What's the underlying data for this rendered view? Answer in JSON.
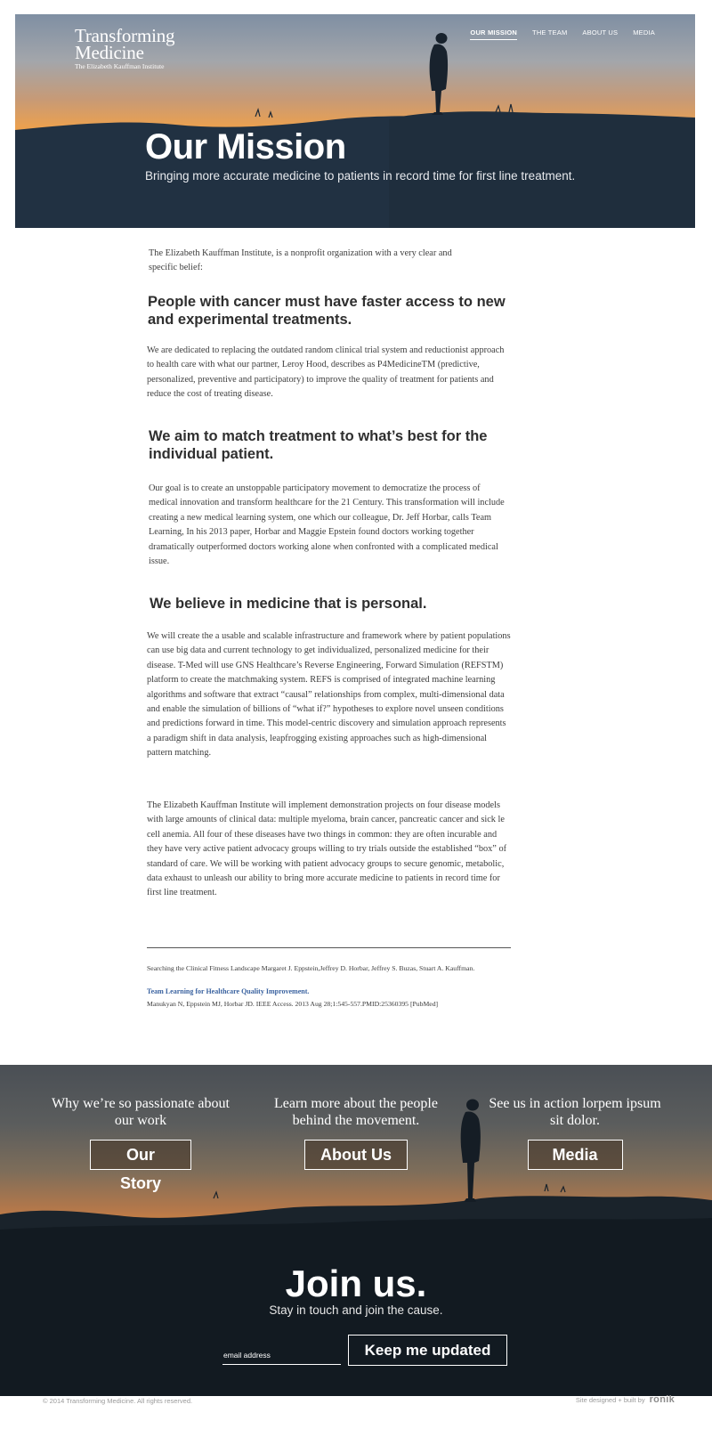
{
  "header": {
    "logo": {
      "line1": "Transforming",
      "line2": "Medicine",
      "line3": "The Elizabeth Kauffman Institute"
    },
    "nav": [
      {
        "label": "OUR MISSION",
        "active": true
      },
      {
        "label": "THE TEAM",
        "active": false
      },
      {
        "label": "ABOUT US",
        "active": false
      },
      {
        "label": "MEDIA",
        "active": false
      }
    ]
  },
  "hero": {
    "title": "Our Mission",
    "subtitle": "Bringing more accurate medicine to patients in record time for first line treatment."
  },
  "article": {
    "intro": "The Elizabeth Kauffman Institute, is a nonprofit organization with a very clear and specific belief:",
    "heading1": "People with cancer must have faster access to new and experimental treatments.",
    "para1": "We are dedicated to replacing the outdated random clinical trial system and reductionist approach to health care with what our partner, Leroy Hood, describes as P4MedicineTM (predictive, personalized, preventive and participatory) to improve the quality of treatment for patients and reduce the cost of treating disease.",
    "heading2": "We aim to match treatment to what’s best for the individual patient.",
    "para2": "Our goal is to create an unstoppable participatory movement to democratize the process of medical innovation and transform healthcare for the 21 Century. This transformation will include creating a new medical learning system, one which our colleague, Dr. Jeff Horbar, calls Team Learning, In his 2013 paper, Horbar and Maggie Epstein found doctors working together dramatically outperformed doctors working alone when confronted with a complicated medical issue.",
    "heading3": "We believe in medicine that is personal.",
    "para3": "We will create the a usable and scalable infrastructure and framework where by patient populations can use big data and current technology to get individualized, personalized medicine for their disease. T-Med will use GNS Healthcare’s Reverse Engineering, Forward Simulation (REFSTM) platform to create the matchmaking system. REFS is comprised of integrated machine learning algorithms and software that extract “causal” relationships from complex, multi-dimensional data and enable the simulation of billions of “what if?” hypotheses to explore novel unseen conditions and predictions forward in time. This model-centric discovery and simulation approach represents a paradigm shift in data analysis, leapfrogging existing approaches such as high-dimensional pattern matching.",
    "para4": "The Elizabeth Kauffman Institute will implement demonstration projects on four disease models with large amounts of clinical data: multiple myeloma, brain cancer, pancreatic cancer and sick le cell anemia. All four of these diseases have two things in common: they are often incurable and they have very active patient advocacy groups willing to try trials outside the established “box” of standard of care. We will be working with patient advocacy groups to secure genomic, metabolic, data exhaust to unleash our ability to bring more accurate medicine to patients in record time for first line treatment."
  },
  "references": {
    "ref1": "Searching the Clinical Fitness Landscape Margaret J. Eppstein,Jeffrey D. Horbar, Jeffrey S. Buzas, Stuart A. Kauffman.",
    "ref2_link": "Team Learning for Healthcare Quality Improvement.",
    "ref2_cite": "Manukyan N, Eppstein MJ, Horbar JD. IEEE Access. 2013 Aug 28;1:545-557.PMID:25360395 [PubMed]"
  },
  "cta": [
    {
      "text": "Why we’re so passionate about our work",
      "button": "Our Story"
    },
    {
      "text": "Learn more about the people behind the movement.",
      "button": "About Us"
    },
    {
      "text": "See us in action lorpem ipsum sit dolor.",
      "button": "Media"
    }
  ],
  "join": {
    "title": "Join us.",
    "subtitle": "Stay in touch and join the cause.",
    "email_placeholder": "email address",
    "button": "Keep me updated"
  },
  "footer": {
    "copyright": "© 2014 Transforming Medicine. All rights reserved.",
    "credit": "Site designed + built by",
    "brand": "ronik"
  }
}
